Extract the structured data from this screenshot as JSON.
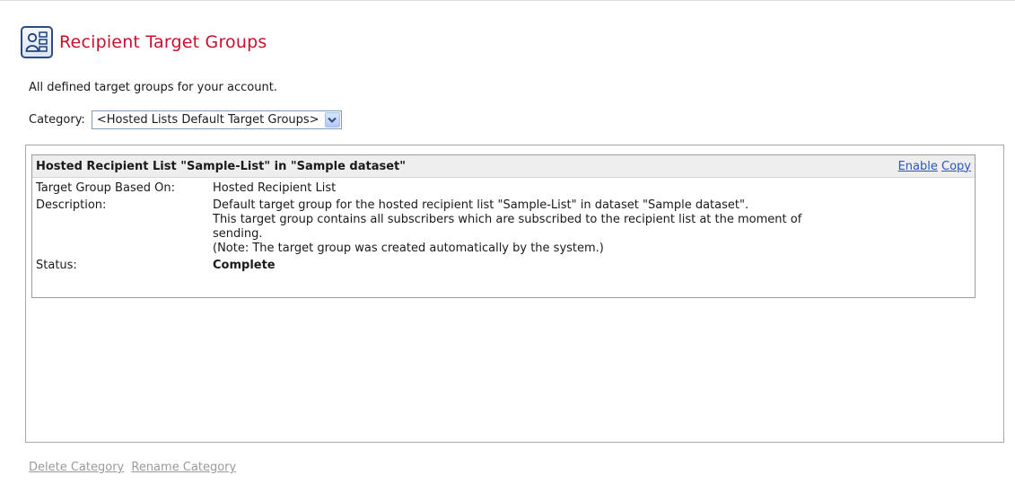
{
  "page": {
    "title": "Recipient Target Groups",
    "intro": "All defined target groups for your account."
  },
  "category": {
    "label": "Category:",
    "selected": "<Hosted Lists Default Target Groups>"
  },
  "target_groups": [
    {
      "title": "Hosted Recipient List \"Sample-List\" in \"Sample dataset\"",
      "actions": {
        "enable": "Enable",
        "copy": "Copy"
      },
      "based_on_label": "Target Group Based On:",
      "based_on_value": "Hosted Recipient List",
      "description_label": "Description:",
      "description_lines": [
        "Default target group for the hosted recipient list \"Sample-List\" in dataset \"Sample dataset\".",
        "This target group contains all subscribers which are subscribed to the recipient list at the moment of",
        "sending.",
        "(Note: The target group was created automatically by the system.)"
      ],
      "status_label": "Status:",
      "status_value": "Complete"
    }
  ],
  "footer": {
    "delete_category": "Delete Category",
    "rename_category": "Rename Category"
  },
  "colors": {
    "title": "#c8102e",
    "link": "#2a56b4",
    "disabled_link": "#9a9a9a"
  },
  "icons": {
    "header": "target-group-icon",
    "dropdown": "chevron-down-icon"
  }
}
